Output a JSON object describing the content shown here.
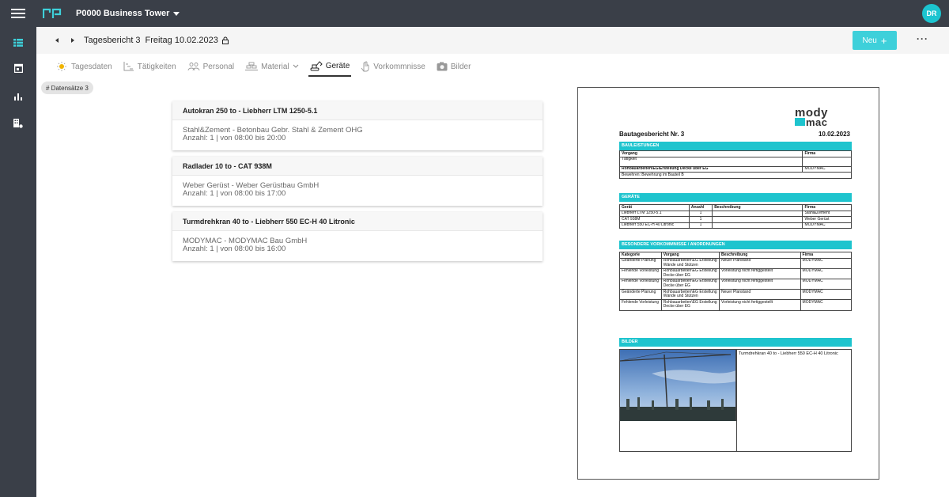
{
  "topbar": {
    "logo": "rp",
    "project": "P0000 Business Tower",
    "avatar": "DR",
    "accent": "#1cc4d0"
  },
  "leftnav": {
    "items": [
      "list-icon",
      "calendar-icon",
      "bar-chart-icon",
      "building-settings-icon"
    ]
  },
  "subheader": {
    "report": "Tagesbericht 3",
    "date": "Freitag 10.02.2023",
    "new_label": "Neu",
    "new_plus": "+",
    "more": "···"
  },
  "tabs": [
    {
      "label": "Tagesdaten",
      "icon": "weather-icon"
    },
    {
      "label": "Tätigkeiten",
      "icon": "activity-icon"
    },
    {
      "label": "Personal",
      "icon": "people-icon"
    },
    {
      "label": "Material",
      "icon": "material-icon"
    },
    {
      "label": "Geräte",
      "icon": "excavator-icon"
    },
    {
      "label": "Vorkommnisse",
      "icon": "hand-icon"
    },
    {
      "label": "Bilder",
      "icon": "camera-icon"
    }
  ],
  "active_tab": "Geräte",
  "chip": "# Datensätze 3",
  "cards": [
    {
      "title": "Autokran 250 to - Liebherr LTM 1250-5.1",
      "company": "Stahl&Zement - Betonbau Gebr. Stahl & Zement OHG",
      "detail": "Anzahl: 1 | von 08:00 bis 20:00"
    },
    {
      "title": "Radlader 10 to - CAT 938M",
      "company": "Weber Gerüst - Weber Gerüstbau GmbH",
      "detail": "Anzahl: 1 | von 08:00 bis 17:00"
    },
    {
      "title": "Turmdrehkran 40 to - Liebherr 550 EC-H 40 Litronic",
      "company": "MODYMAC - MODYMAC Bau GmbH",
      "detail": "Anzahl: 1 | von 08:00 bis 16:00"
    }
  ],
  "doc": {
    "logo_line1": "mody",
    "logo_line2": "mac",
    "title": "Bautagesbericht Nr. 3",
    "date": "10.02.2023",
    "bauleistungen": {
      "header": "BAULEISTUNGEN",
      "col_vorgang": "Vorgang",
      "col_firma": "Firma",
      "row1": "Tätigkeit",
      "row2_vorgang": "Rohbauarbeiten\\EG\\Erstellung Decke über EG",
      "row2_firma": "MODYMAC",
      "row3": "Bewehren: Bewehrung im Bauteil B"
    },
    "geraete": {
      "header": "GERÄTE",
      "cols": [
        "Gerät",
        "Anzahl",
        "Beschreibung",
        "Firma"
      ],
      "rows": [
        [
          "Liebherr LTM 1250-5.1",
          "1",
          "",
          "Stahl&Zement"
        ],
        [
          "CAT 938M",
          "1",
          "",
          "Weber Gerüst"
        ],
        [
          "Liebherr 550 EC-H 40 Litronic",
          "1",
          "",
          "MODYMAC"
        ]
      ]
    },
    "vorkommnisse": {
      "header": "BESONDERE VORKOMMNISSE / ANORDNUNGEN",
      "cols": [
        "Kategorie",
        "Vorgang",
        "Beschreibung",
        "Firma"
      ],
      "rows": [
        [
          "Geänderte Planung",
          "Rohbauarbeiten\\EG Erstellung Wände und Stützen",
          "Neuer Planstand",
          "MODYMAC"
        ],
        [
          "Fehlende Vorleistung",
          "Rohbauarbeiten\\EG Erstellung Decke über EG",
          "Vorleistung nicht fertiggestellt",
          "MODYMAC"
        ],
        [
          "Fehlende Vorleistung",
          "Rohbauarbeiten\\EG Erstellung Decke über EG",
          "Vorleistung nicht fertiggestellt",
          "MODYMAC"
        ],
        [
          "Geänderte Planung",
          "Rohbauarbeiten\\EG Erstellung Wände und Stützen",
          "Neuer Planstand",
          "MODYMAC"
        ],
        [
          "Fehlende Vorleistung",
          "Rohbauarbeiten\\EG Erstellung Decke über EG",
          "Vorleistung nicht fertiggestellt",
          "MODYMAC"
        ]
      ]
    },
    "bilder": {
      "header": "BILDER",
      "caption": "Turmdrehkran 40 to - Liebherr 550 EC-H 40 Litronic"
    }
  }
}
